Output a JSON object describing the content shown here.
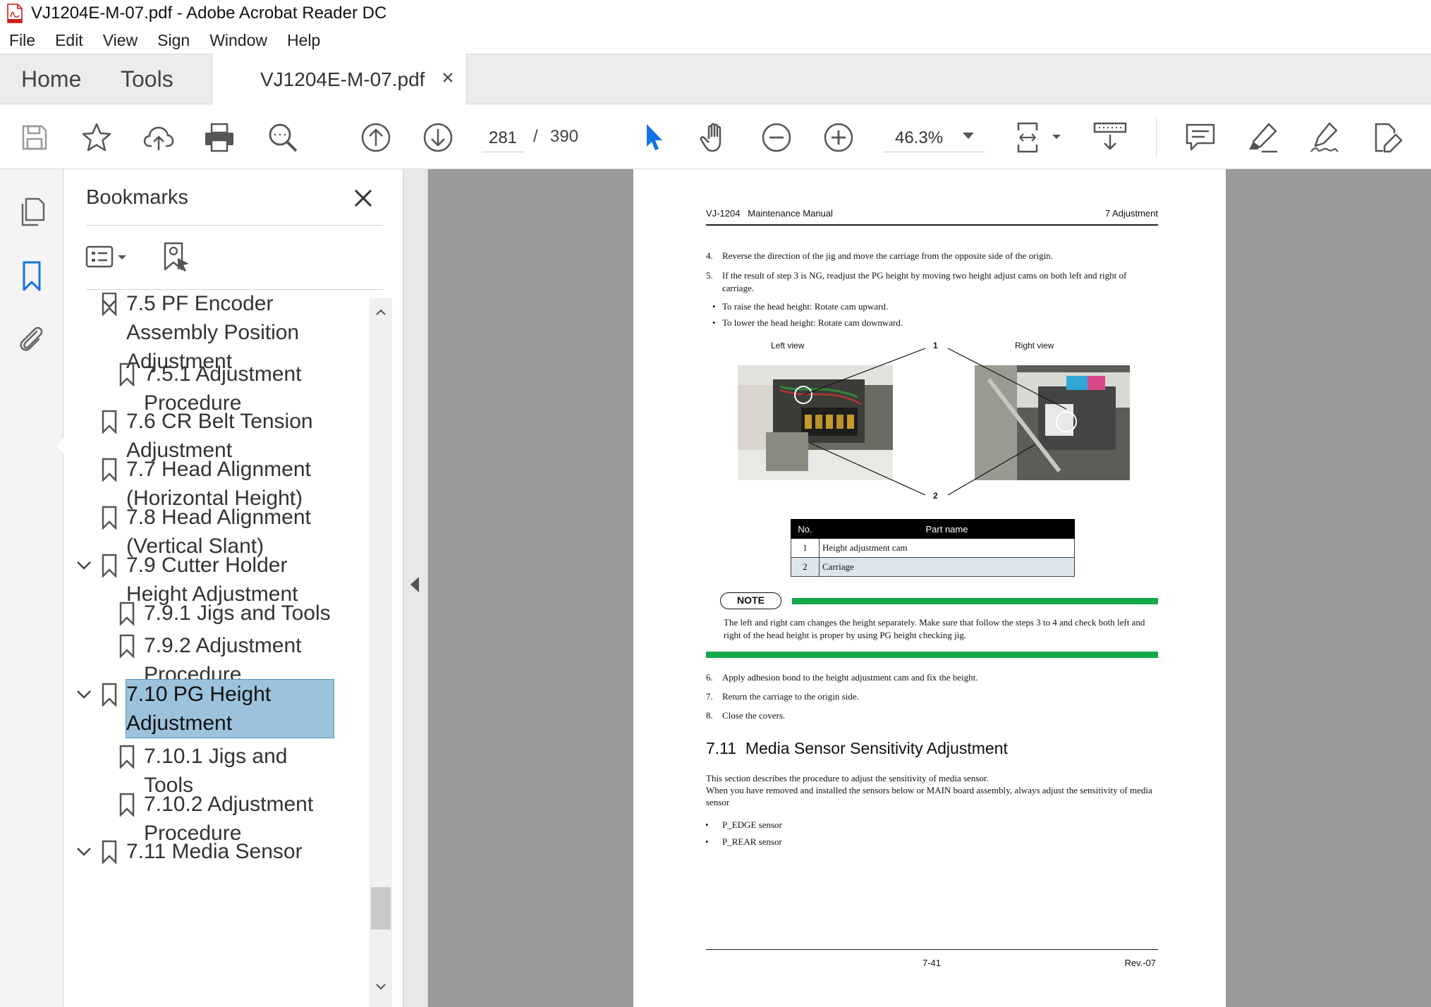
{
  "window": {
    "title": "VJ1204E-M-07.pdf - Adobe Acrobat Reader DC"
  },
  "menu": [
    "File",
    "Edit",
    "View",
    "Sign",
    "Window",
    "Help"
  ],
  "tabs": {
    "home": "Home",
    "tools": "Tools",
    "document": "VJ1204E-M-07.pdf"
  },
  "toolbar": {
    "page_current": "281",
    "page_separator": "/",
    "page_total": "390",
    "zoom": "46.3%",
    "accent_color": "#1473e6"
  },
  "bookmarks": {
    "title": "Bookmarks",
    "items": [
      {
        "label_lines": [
          "7.5 PF Encoder",
          "Assembly Position",
          "Adjustment"
        ],
        "expanded": true
      },
      {
        "label_lines": [
          "7.5.1 Adjustment",
          "Procedure"
        ]
      },
      {
        "label_lines": [
          "7.6 CR Belt Tension",
          "Adjustment"
        ]
      },
      {
        "label_lines": [
          "7.7 Head Alignment",
          "(Horizontal Height)"
        ]
      },
      {
        "label_lines": [
          "7.8 Head Alignment",
          "(Vertical Slant)"
        ]
      },
      {
        "label_lines": [
          "7.9 Cutter Holder",
          "Height Adjustment"
        ],
        "expanded": true
      },
      {
        "label_lines": [
          "7.9.1 Jigs and Tools"
        ]
      },
      {
        "label_lines": [
          "7.9.2 Adjustment",
          "Procedure"
        ]
      },
      {
        "label_lines": [
          "7.10 PG Height",
          "Adjustment"
        ],
        "expanded": true,
        "selected": true
      },
      {
        "label_lines": [
          "7.10.1 Jigs and",
          "Tools"
        ]
      },
      {
        "label_lines": [
          "7.10.2 Adjustment",
          "Procedure"
        ]
      },
      {
        "label_lines": [
          "7.11 Media Sensor"
        ],
        "expanded": true
      }
    ],
    "selected_color": "#9cc3dd"
  },
  "page": {
    "header_left": "VJ-1204   Maintenance Manual",
    "header_right": "7 Adjustment",
    "steps_a": [
      {
        "n": "4.",
        "text": "Reverse the direction of the jig and move the carriage from the opposite side of the origin."
      },
      {
        "n": "5.",
        "text": "If the result of step 3 is NG, readjust the PG height by moving two height adjust cams on both left and right of carriage."
      }
    ],
    "bullets_a": [
      "To raise the head height: Rotate cam upward.",
      "To lower the head height: Rotate cam downward."
    ],
    "figure": {
      "left_label": "Left view",
      "right_label": "Right view",
      "callout_1": "1",
      "callout_2": "2"
    },
    "table": {
      "headers": [
        "No.",
        "Part name"
      ],
      "rows": [
        [
          "1",
          "Height adjustment cam"
        ],
        [
          "2",
          "Carriage"
        ]
      ]
    },
    "note": {
      "badge": "NOTE",
      "text": "The left and right cam changes the height separately. Make sure that follow the steps 3 to 4 and check both left and right of the head height is proper by using PG height checking jig.",
      "color": "#13a84a"
    },
    "steps_b": [
      {
        "n": "6.",
        "text": "Apply adhesion bond to the height adjustment cam and fix the height."
      },
      {
        "n": "7.",
        "text": "Return the carriage to the origin side."
      },
      {
        "n": "8.",
        "text": "Close the covers."
      }
    ],
    "section_heading": "7.11  Media Sensor Sensitivity Adjustment",
    "section_body_1": "This section describes the procedure to adjust the sensitivity of media sensor.",
    "section_body_2": "When you have removed and installed the sensors below or MAIN board assembly, always adjust the sensitivity of media sensor",
    "section_bullets": [
      "P_EDGE sensor",
      "P_REAR sensor"
    ],
    "footer_page": "7-41",
    "footer_rev": "Rev.-07"
  }
}
